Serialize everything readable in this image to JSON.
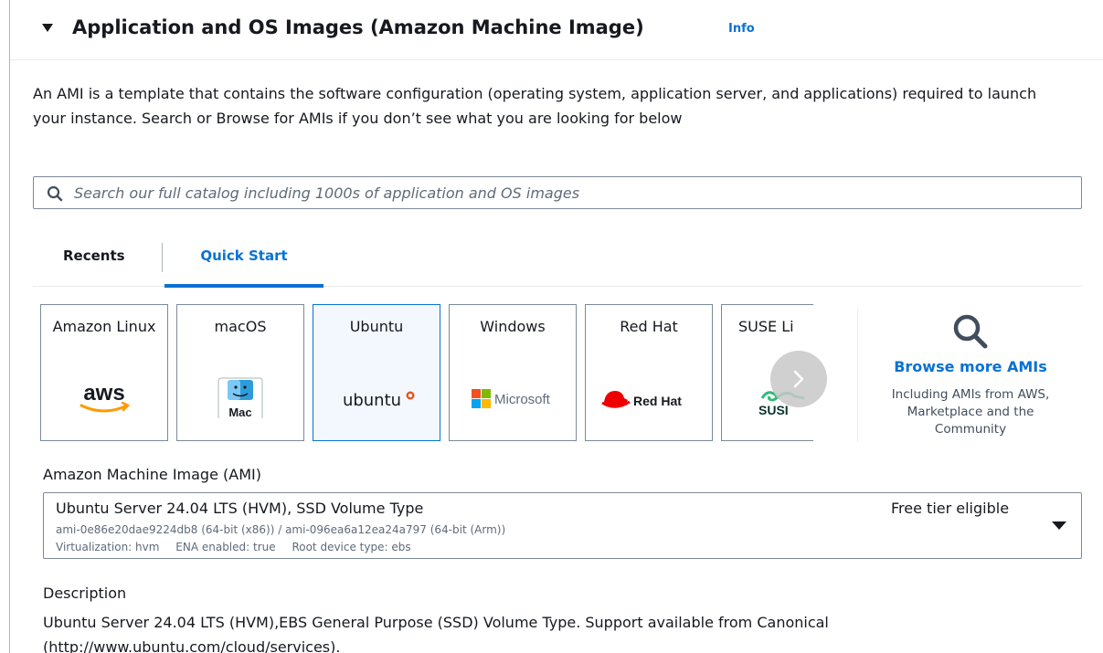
{
  "section": {
    "title": "Application and OS Images (Amazon Machine Image)",
    "info_link": "Info",
    "intro": "An AMI is a template that contains the software configuration (operating system, application server, and applications) required to launch your instance. Search or Browse for AMIs if you don’t see what you are looking for below"
  },
  "search": {
    "placeholder": "Search our full catalog including 1000s of application and OS images",
    "value": ""
  },
  "tabs": [
    {
      "label": "Recents",
      "active": false
    },
    {
      "label": "Quick Start",
      "active": true
    }
  ],
  "ami_tiles": [
    {
      "label": "Amazon Linux",
      "logo": "aws-logo",
      "logo_text": "aws",
      "selected": false
    },
    {
      "label": "macOS",
      "logo": "mac-finder-logo",
      "logo_text": "Mac",
      "selected": false
    },
    {
      "label": "Ubuntu",
      "logo": "ubuntu-logo",
      "logo_text": "ubuntu",
      "selected": true
    },
    {
      "label": "Windows",
      "logo": "microsoft-logo",
      "logo_text": "Microsoft",
      "selected": false
    },
    {
      "label": "Red Hat",
      "logo": "redhat-logo",
      "logo_text": "Red Hat",
      "selected": false
    },
    {
      "label": "SUSE Li",
      "logo": "suse-logo",
      "logo_text": "SUSI",
      "selected": false
    }
  ],
  "browse": {
    "link": "Browse more AMIs",
    "subtitle": "Including AMIs from AWS, Marketplace and the Community"
  },
  "ami_select": {
    "label": "Amazon Machine Image (AMI)",
    "name": "Ubuntu Server 24.04 LTS (HVM), SSD Volume Type",
    "badge": "Free tier eligible",
    "ids": "ami-0e86e20dae9224db8 (64-bit (x86)) / ami-096ea6a12ea24a797 (64-bit (Arm))",
    "virtualization": "Virtualization: hvm",
    "ena": "ENA enabled: true",
    "root_device": "Root device type: ebs"
  },
  "description": {
    "label": "Description",
    "text": "Ubuntu Server 24.04 LTS (HVM),EBS General Purpose (SSD) Volume Type. Support available from Canonical (http://www.ubuntu.com/cloud/services)."
  },
  "colors": {
    "link_blue": "#0972d3",
    "border_gray": "#7d8998",
    "text_dark": "#16191f",
    "muted": "#5f6b7a",
    "selected_bg": "#f2f8fd",
    "aws_orange": "#ff9900",
    "ubuntu_orange": "#e95420",
    "redhat_red": "#ee0000",
    "suse_green": "#30ba78"
  }
}
